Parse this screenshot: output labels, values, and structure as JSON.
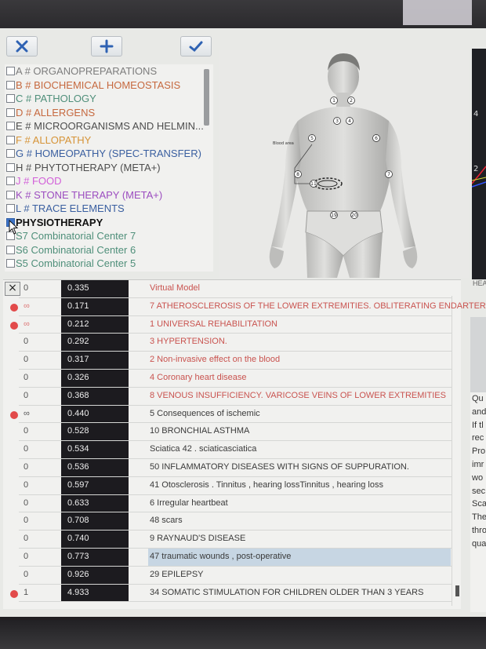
{
  "toolbar": {
    "close_icon": "x-icon",
    "add_icon": "plus-icon",
    "accept_icon": "check-icon"
  },
  "categories": [
    {
      "label": "A # ORGANOPREPARATIONS",
      "color": "#7d7d7d",
      "checked": false
    },
    {
      "label": "B # BIOCHEMICAL HOMEOSTASIS",
      "color": "#c6693f",
      "checked": false
    },
    {
      "label": "C # PATHOLOGY",
      "color": "#4f8f7a",
      "checked": false
    },
    {
      "label": "D # ALLERGENS",
      "color": "#c6693f",
      "checked": false
    },
    {
      "label": "E # MICROORGANISMS AND HELMIN...",
      "color": "#4d4d4d",
      "checked": false
    },
    {
      "label": "F # ALLOPATHY",
      "color": "#d69438",
      "checked": false
    },
    {
      "label": "G # HOMEOPATHY (SPEC-TRANSFER)",
      "color": "#3a5fa0",
      "checked": false
    },
    {
      "label": "H # PHYTOTHERAPY (META+)",
      "color": "#4d4d4d",
      "checked": false
    },
    {
      "label": "J # FOOD",
      "color": "#d25fd9",
      "checked": false
    },
    {
      "label": "K # STONE THERAPY (META+)",
      "color": "#9c4dc0",
      "checked": false
    },
    {
      "label": "L # TRACE ELEMENTS",
      "color": "#3a5fa0",
      "checked": false
    },
    {
      "label": "PHYSIOTHERAPY",
      "color": "#111111",
      "checked": true
    },
    {
      "label": "S7 Combinatorial Center 7",
      "color": "#4f8f7a",
      "checked": false
    },
    {
      "label": "S6 Combinatorial Center 6",
      "color": "#4f8f7a",
      "checked": false
    },
    {
      "label": "S5 Combinatorial Center 5",
      "color": "#4f8f7a",
      "checked": false
    }
  ],
  "body_figure": {
    "markers": [
      "1",
      "2",
      "3",
      "4",
      "5",
      "6",
      "7",
      "8",
      "11",
      "19",
      "20"
    ],
    "annotation": "Blood area"
  },
  "right_panel": {
    "digit_top": "4",
    "digit_bottom": "2",
    "header_cut": "HEA"
  },
  "results": {
    "close_label": "×",
    "rows": [
      {
        "bullet": false,
        "sym": "0",
        "value": "0.335",
        "name": "Virtual Model",
        "red": true
      },
      {
        "bullet": true,
        "sym": "∞",
        "value": "0.171",
        "name": "7 ATHEROSCLEROSIS OF THE LOWER EXTREMITIES. OBLITERATING ENDARTERI",
        "red": true
      },
      {
        "bullet": true,
        "sym": "∞",
        "value": "0.212",
        "name": "1 UNIVERSAL REHABILITATION",
        "red": true
      },
      {
        "bullet": false,
        "sym": "0",
        "value": "0.292",
        "name": "3 HYPERTENSION.",
        "red": true
      },
      {
        "bullet": false,
        "sym": "0",
        "value": "0.317",
        "name": "2 Non-invasive effect on the blood",
        "red": true
      },
      {
        "bullet": false,
        "sym": "0",
        "value": "0.326",
        "name": "4 Coronary heart disease",
        "red": true
      },
      {
        "bullet": false,
        "sym": "0",
        "value": "0.368",
        "name": "8 VENOUS INSUFFICIENCY. VARICOSE VEINS OF LOWER EXTREMITIES",
        "red": true
      },
      {
        "bullet": true,
        "sym": "∞",
        "value": "0.440",
        "name": "5 Consequences of ischemic",
        "red": false
      },
      {
        "bullet": false,
        "sym": "0",
        "value": "0.528",
        "name": "10 BRONCHIAL ASTHMA",
        "red": false
      },
      {
        "bullet": false,
        "sym": "0",
        "value": "0.534",
        "name": "Sciatica 42 . sciaticasciatica",
        "red": false
      },
      {
        "bullet": false,
        "sym": "0",
        "value": "0.536",
        "name": "50 INFLAMMATORY DISEASES WITH SIGNS OF SUPPURATION.",
        "red": false
      },
      {
        "bullet": false,
        "sym": "0",
        "value": "0.597",
        "name": "41 Otosclerosis . Tinnitus , hearing lossTinnitus , hearing loss",
        "red": false
      },
      {
        "bullet": false,
        "sym": "0",
        "value": "0.633",
        "name": "6 Irregular heartbeat",
        "red": false
      },
      {
        "bullet": false,
        "sym": "0",
        "value": "0.708",
        "name": "48 scars",
        "red": false
      },
      {
        "bullet": false,
        "sym": "0",
        "value": "0.740",
        "name": "9 RAYNAUD'S DISEASE",
        "red": false
      },
      {
        "bullet": false,
        "sym": "0",
        "value": "0.773",
        "name": "47 traumatic wounds , post-operative",
        "red": false,
        "highlight": true
      },
      {
        "bullet": false,
        "sym": "0",
        "value": "0.926",
        "name": "29 EPILEPSY",
        "red": false
      },
      {
        "bullet": true,
        "sym": "1",
        "value": "4.933",
        "name": "34 SOMATIC STIMULATION FOR CHILDREN OLDER THAN 3 YEARS",
        "red": false
      }
    ]
  },
  "info_panel": {
    "lines": [
      "Qu",
      "and",
      "If tl",
      "rec",
      " Pro",
      "imr",
      "wo",
      "sec",
      "Sca",
      "The",
      "thro",
      "qua"
    ]
  }
}
